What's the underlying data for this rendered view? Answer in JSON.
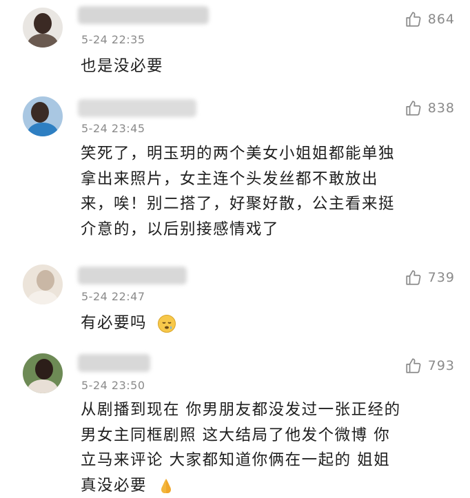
{
  "comments": [
    {
      "time": "5-24 22:35",
      "likes": "864",
      "text": "也是没必要"
    },
    {
      "time": "5-24 23:45",
      "likes": "838",
      "lines": [
        "笑死了，明玉玥的两个美女小姐姐都能单独",
        "拿出来照片，女主连个头发丝都不敢放出",
        "来，唉！别二搭了，好聚好散，公主看来挺",
        "介意的，以后别接感情戏了"
      ]
    },
    {
      "time": "5-24 22:47",
      "likes": "739",
      "text": "有必要吗",
      "emoji": "sleepy-face-emoji"
    },
    {
      "time": "5-24 23:50",
      "likes": "793",
      "lines": [
        "从剧播到现在 你男朋友都没发过一张正经的",
        "男女主同框剧照 这大结局了他发个微博 你",
        "立马来评论 大家都知道你俩在一起的 姐姐",
        "真没必要"
      ],
      "emoji": "praying-hands-emoji"
    }
  ],
  "colors": {
    "meta": "#8a8a8a",
    "text": "#1e1e1e",
    "blur": "#d9d9d9"
  }
}
